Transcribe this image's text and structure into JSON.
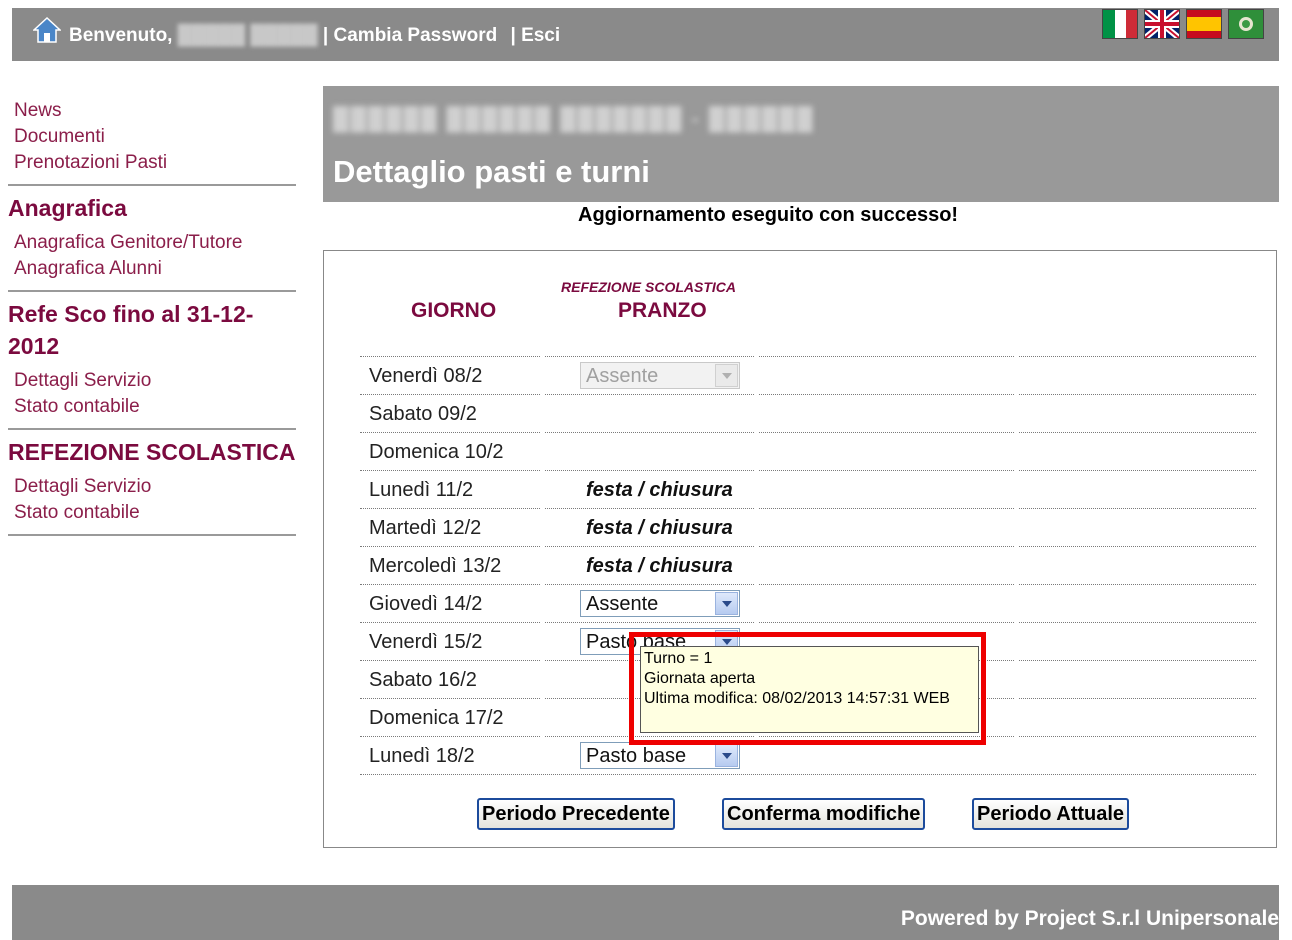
{
  "topbar": {
    "welcome": "Benvenuto,",
    "username": "█████ █████",
    "change_password": "| Cambia Password",
    "logout": "| Esci",
    "flags": [
      "italian-flag-icon",
      "uk-flag-icon",
      "spanish-flag-icon",
      "green-emblem-flag-icon"
    ]
  },
  "sidebar": {
    "links_top": [
      "News",
      "Documenti",
      "Prenotazioni Pasti"
    ],
    "section1": {
      "title": "Anagrafica",
      "links": [
        "Anagrafica Genitore/Tutore",
        "Anagrafica Alunni"
      ]
    },
    "section2": {
      "title": "Refe Sco fino al 31-12-2012",
      "links": [
        "Dettagli Servizio",
        "Stato contabile"
      ]
    },
    "section3": {
      "title": "REFEZIONE SCOLASTICA",
      "links": [
        "Dettagli Servizio",
        "Stato contabile"
      ]
    }
  },
  "header": {
    "school_name_blurred": "██████ ██████ ███████ - ██████",
    "title": "Dettaglio pasti e turni"
  },
  "message": "Aggiornamento eseguito con successo!",
  "table": {
    "col_day": "GIORNO",
    "service_name": "REFEZIONE SCOLASTICA",
    "col_meal": "PRANZO",
    "rows": [
      {
        "day": "Venerdì 08/2",
        "type": "select",
        "value": "Assente",
        "disabled": true
      },
      {
        "day": "Sabato 09/2",
        "type": "empty"
      },
      {
        "day": "Domenica 10/2",
        "type": "empty"
      },
      {
        "day": "Lunedì 11/2",
        "type": "text",
        "value": "festa / chiusura"
      },
      {
        "day": "Martedì 12/2",
        "type": "text",
        "value": "festa / chiusura"
      },
      {
        "day": "Mercoledì 13/2",
        "type": "text",
        "value": "festa / chiusura"
      },
      {
        "day": "Giovedì 14/2",
        "type": "select",
        "value": "Assente"
      },
      {
        "day": "Venerdì 15/2",
        "type": "select",
        "value": "Pasto base"
      },
      {
        "day": "Sabato 16/2",
        "type": "empty"
      },
      {
        "day": "Domenica 17/2",
        "type": "empty"
      },
      {
        "day": "Lunedì 18/2",
        "type": "select",
        "value": "Pasto base"
      }
    ]
  },
  "buttons": {
    "previous": "Periodo Precedente",
    "confirm": "Conferma modifiche",
    "current": "Periodo Attuale"
  },
  "tooltip": {
    "line1": "Turno = 1",
    "line2": "Giornata aperta",
    "line3": "Ultima modifica: 08/02/2013 14:57:31 WEB"
  },
  "footer": {
    "text": "Powered by Project S.r.l Unipersonale"
  },
  "colors": {
    "bar_gray": "#8a8a8a",
    "accent_burgundy": "#7b0a3f",
    "highlight_red": "#ee0000",
    "tooltip_bg": "#ffffe1"
  }
}
